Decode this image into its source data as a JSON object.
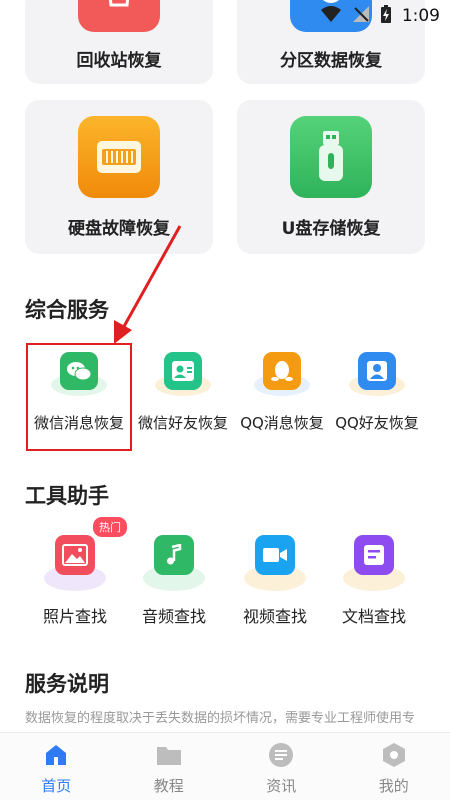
{
  "status_bar": {
    "time": "1:09"
  },
  "recovery_cards": [
    {
      "label": "回收站恢复",
      "color": "#f25a5a"
    },
    {
      "label": "分区数据恢复",
      "color": "#2f8bf0"
    },
    {
      "label": "硬盘故障恢复",
      "color": "#f5a20f"
    },
    {
      "label": "U盘存储恢复",
      "color": "#3fc46a"
    }
  ],
  "services": {
    "title": "综合服务",
    "items": [
      {
        "label": "微信消息恢复",
        "color": "#2fb865",
        "icon": "wechat-icon"
      },
      {
        "label": "微信好友恢复",
        "color": "#23c38a",
        "icon": "contact-card-icon"
      },
      {
        "label": "QQ消息恢复",
        "color": "#f59b12",
        "icon": "qq-penguin-icon"
      },
      {
        "label": "QQ好友恢复",
        "color": "#2f8bf0",
        "icon": "user-badge-icon"
      }
    ]
  },
  "tools": {
    "title": "工具助手",
    "hot_badge": "热门",
    "items": [
      {
        "label": "照片查找",
        "color": "#f24d5c",
        "icon": "photo-icon"
      },
      {
        "label": "音频查找",
        "color": "#2fb865",
        "icon": "music-note-icon"
      },
      {
        "label": "视频查找",
        "color": "#1aa3f0",
        "icon": "video-camera-icon"
      },
      {
        "label": "文档查找",
        "color": "#8e4cf0",
        "icon": "document-icon"
      }
    ]
  },
  "service_info": {
    "title": "服务说明",
    "text": "数据恢复的程度取决于丢失数据的损坏情况，需要专业工程师使用专业检测工具分析后才能知道具体情况，保证并不能"
  },
  "tabbar": {
    "items": [
      {
        "label": "首页",
        "icon": "home-icon",
        "active": true
      },
      {
        "label": "教程",
        "icon": "folder-icon",
        "active": false
      },
      {
        "label": "资讯",
        "icon": "news-icon",
        "active": false
      },
      {
        "label": "我的",
        "icon": "profile-icon",
        "active": false
      }
    ],
    "active_color": "#2f7bf5"
  }
}
